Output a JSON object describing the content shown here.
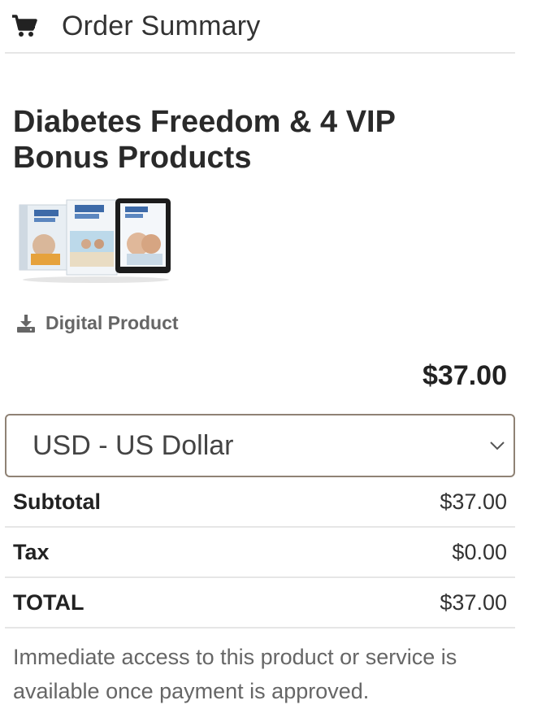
{
  "header": {
    "title": "Order Summary",
    "icon": "shopping-cart-icon"
  },
  "product": {
    "title_line1": "Diabetes Freedom & 4 VIP",
    "title_line2": "Bonus Products",
    "image_alt": "product-bundle-image",
    "type_label": "Digital Product",
    "type_icon": "download-icon",
    "price": "$37.00"
  },
  "currency": {
    "selected": "USD - US Dollar"
  },
  "summary": {
    "rows": [
      {
        "label": "Subtotal",
        "value": "$37.00"
      },
      {
        "label": "Tax",
        "value": "$0.00"
      },
      {
        "label": "TOTAL",
        "value": "$37.00"
      }
    ]
  },
  "note": "Immediate access to this product or service is available once payment is approved.",
  "colors": {
    "border": "#e6e6e6",
    "select_border": "#8f8275",
    "muted_text": "#666666"
  }
}
